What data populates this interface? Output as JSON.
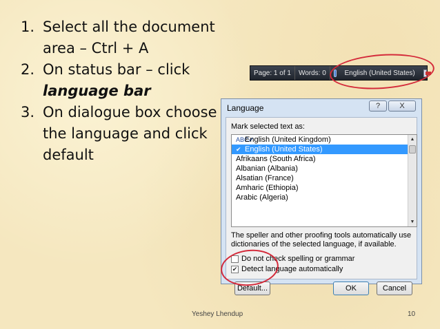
{
  "bullets": [
    {
      "num": "1.",
      "text": "Select all the document area – Ctrl + A"
    },
    {
      "num": "2.",
      "text_before": "On status bar – click ",
      "text_bold": "language bar"
    },
    {
      "num": "3.",
      "text": " On dialogue box choose the language and click default"
    }
  ],
  "statusbar": {
    "page": "Page: 1 of 1",
    "words": "Words: 0",
    "language": "English (United States)",
    "icon": "proofing-icon"
  },
  "dialog": {
    "title": "Language",
    "help_label": "?",
    "close_label": "X",
    "mark_label": "Mark selected text as:",
    "languages": [
      {
        "label": "English (United Kingdom)",
        "mark": "ABC✔",
        "selected": false
      },
      {
        "label": "English (United States)",
        "mark": "✔",
        "selected": true
      },
      {
        "label": "Afrikaans (South Africa)",
        "mark": "",
        "selected": false
      },
      {
        "label": "Albanian (Albania)",
        "mark": "",
        "selected": false
      },
      {
        "label": "Alsatian (France)",
        "mark": "",
        "selected": false
      },
      {
        "label": "Amharic (Ethiopia)",
        "mark": "",
        "selected": false
      },
      {
        "label": "Arabic (Algeria)",
        "mark": "",
        "selected": false
      }
    ],
    "description": "The speller and other proofing tools automatically use dictionaries of the selected language, if available.",
    "checkbox_no_check": {
      "label": "Do not check spelling or grammar",
      "checked": false
    },
    "checkbox_detect": {
      "label": "Detect language automatically",
      "checked": true
    },
    "default_label": "Default...",
    "ok_label": "OK",
    "cancel_label": "Cancel"
  },
  "footer": {
    "author": "Yeshey Lhendup",
    "page_number": "10"
  },
  "colors": {
    "background": "#f5e7bf",
    "highlight_circle": "#d42a3a",
    "selection": "#3399ff"
  }
}
